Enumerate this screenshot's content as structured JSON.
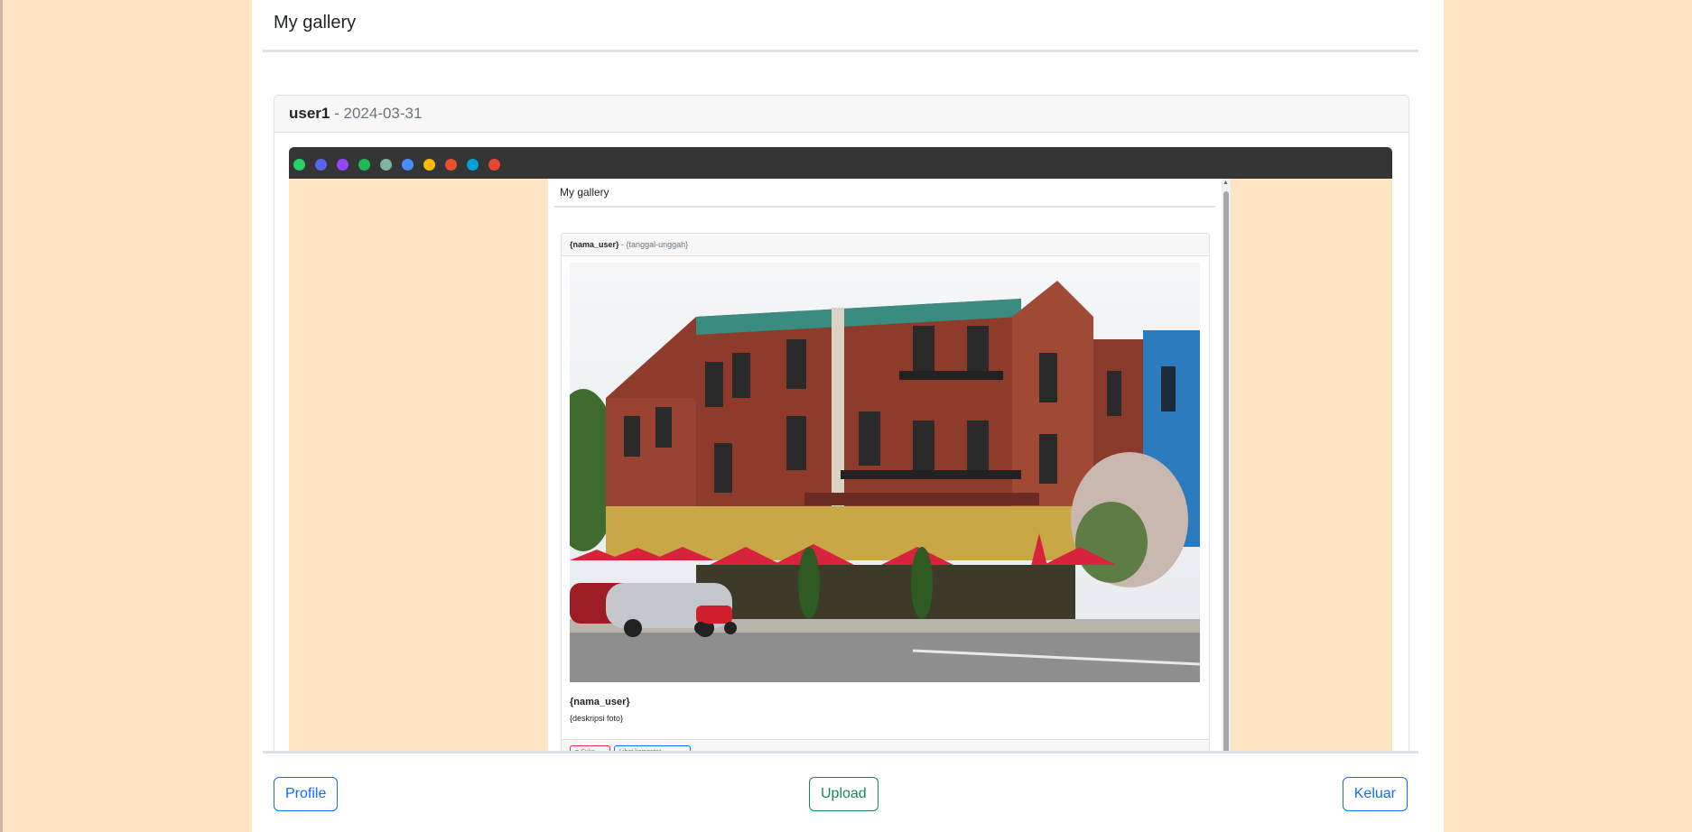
{
  "page": {
    "title": "My gallery"
  },
  "post": {
    "username": "user1",
    "separator": " - ",
    "date": "2024-03-31"
  },
  "screenshot": {
    "bookmark_icons": [
      {
        "name": "whatsapp-icon",
        "color": "#25d366"
      },
      {
        "name": "discord-icon",
        "color": "#5865f2"
      },
      {
        "name": "twitch-icon",
        "color": "#9146ff"
      },
      {
        "name": "spotify-icon",
        "color": "#1db954"
      },
      {
        "name": "app-icon",
        "color": "#7fb3a3"
      },
      {
        "name": "sparkle-icon",
        "color": "#4a8cff"
      },
      {
        "name": "drive-icon",
        "color": "#fbbc04"
      },
      {
        "name": "bag-icon",
        "color": "#e94f2e"
      },
      {
        "name": "bilibili-icon",
        "color": "#00a1d6"
      },
      {
        "name": "gmail-icon",
        "color": "#ea4335"
      }
    ],
    "inner_title": "My gallery",
    "inner_card": {
      "user": "{nama_user}",
      "separator": " - ",
      "date": "{tanggal-unggah}",
      "name": "{nama_user}",
      "description": "{deskripsi foto}",
      "like_label": "♥ Suka",
      "comment_label": "Lihat komentar"
    }
  },
  "footer": {
    "profile_label": "Profile",
    "upload_label": "Upload",
    "logout_label": "Keluar"
  },
  "colors": {
    "background": "#ffe4c4",
    "primary": "#0d6efd",
    "success": "#198754"
  }
}
